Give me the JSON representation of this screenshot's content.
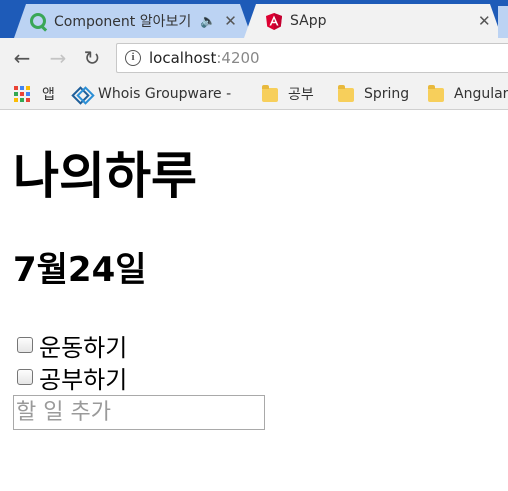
{
  "browser": {
    "tabs": [
      {
        "title": "Component 알아보기",
        "icon": "google-search-icon",
        "audio": true,
        "active": false
      },
      {
        "title": "SApp",
        "icon": "angular-icon",
        "active": true
      }
    ],
    "close_glyph": "✕",
    "address": {
      "host": "localhost",
      "port": ":4200"
    },
    "bookmarks": [
      {
        "label": "앱",
        "icon": "apps-grid-icon"
      },
      {
        "label": "Whois Groupware -",
        "icon": "whois-icon"
      },
      {
        "label": "공부",
        "icon": "folder-icon"
      },
      {
        "label": "Spring",
        "icon": "folder-icon"
      },
      {
        "label": "Angular",
        "icon": "folder-icon"
      }
    ],
    "colors": {
      "tabstrip": "#1e5bb8",
      "angular_red": "#dd0031",
      "folder": "#f7cf5b"
    }
  },
  "app": {
    "title": "나의하루",
    "date": "7월24일",
    "todos": [
      {
        "label": "운동하기",
        "checked": false
      },
      {
        "label": "공부하기",
        "checked": false
      }
    ],
    "new_todo": {
      "value": "",
      "placeholder": "할 일 추가"
    }
  }
}
